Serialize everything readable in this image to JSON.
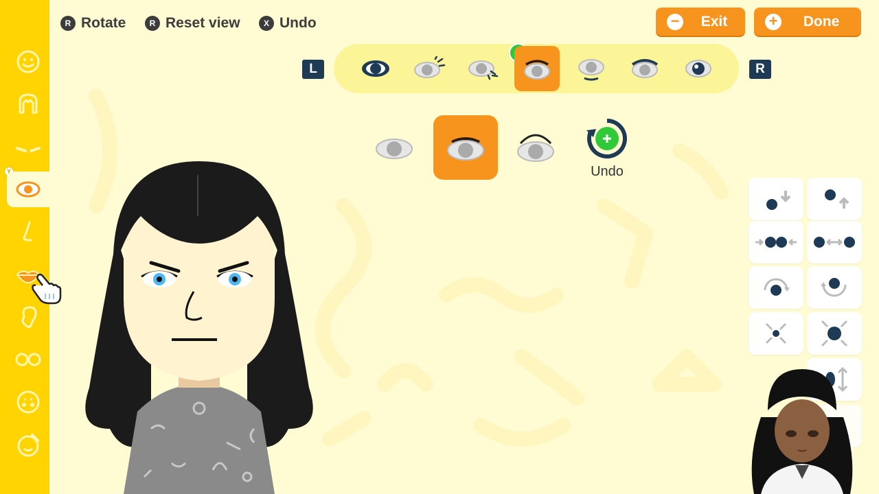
{
  "top_hints": [
    {
      "glyph": "R",
      "label": "Rotate"
    },
    {
      "glyph": "R",
      "label": "Reset view"
    },
    {
      "glyph": "X",
      "label": "Undo"
    }
  ],
  "buttons": {
    "exit": {
      "icon": "−",
      "label": "Exit"
    },
    "done": {
      "icon": "+",
      "label": "Done"
    }
  },
  "shoulders": {
    "left": "L",
    "right": "R"
  },
  "eye_tabs": {
    "items": [
      "eye-type",
      "eye-color",
      "eye-size",
      "eye-shape-lid",
      "eye-position",
      "eye-rotation",
      "eye-highlight"
    ],
    "selected_index": 3
  },
  "eye_options": {
    "items": [
      "no-lid-line",
      "thick-lid-line",
      "arched-lid-line"
    ],
    "selected_index": 1
  },
  "undo_tile": {
    "label": "Undo"
  },
  "sidebar": {
    "badge": "Y",
    "items": [
      "face-icon",
      "hair-icon",
      "eyebrows-icon",
      "eyes-icon",
      "nose-icon",
      "mouth-icon",
      "ears-icon",
      "glasses-icon",
      "makeup-icon",
      "accessories-icon"
    ],
    "active_index": 3
  },
  "adjust_buttons": [
    "move-down",
    "move-up",
    "closer",
    "farther",
    "rotate-cw",
    "rotate-ccw",
    "smaller",
    "larger",
    "stretch-vertical"
  ],
  "colors": {
    "sidebar": "#ffd400",
    "background": "#fffbd2",
    "accent": "#f7941d",
    "strip": "#fbf598",
    "eye": "#4fb8f2",
    "hair": "#1b1b1b"
  }
}
